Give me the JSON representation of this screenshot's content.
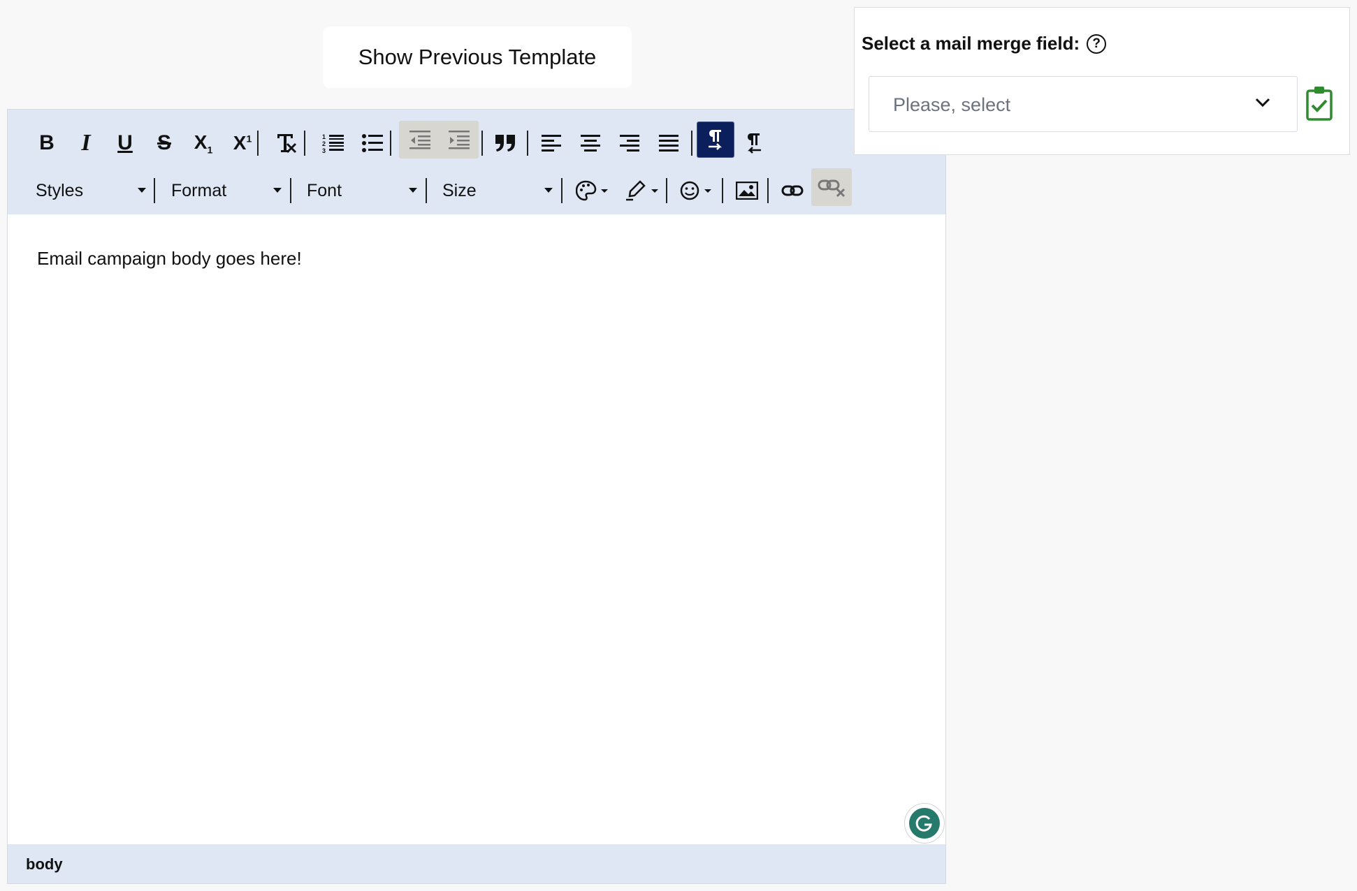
{
  "header": {
    "show_previous_label": "Show Previous Template"
  },
  "editor": {
    "toolbar_row1": [
      {
        "name": "bold-button",
        "icon": "bold-icon",
        "glyph": "B"
      },
      {
        "name": "italic-button",
        "icon": "italic-icon",
        "glyph": "I"
      },
      {
        "name": "underline-button",
        "icon": "underline-icon",
        "glyph": "U"
      },
      {
        "name": "strikethrough-button",
        "icon": "strikethrough-icon",
        "glyph": "S"
      },
      {
        "name": "subscript-button",
        "icon": "subscript-icon",
        "glyph": "X₁"
      },
      {
        "name": "superscript-button",
        "icon": "superscript-icon",
        "glyph": "X¹"
      },
      {
        "name": "remove-format-button",
        "icon": "remove-format-icon"
      },
      {
        "name": "numbered-list-button",
        "icon": "numbered-list-icon"
      },
      {
        "name": "bulleted-list-button",
        "icon": "bulleted-list-icon"
      },
      {
        "name": "decrease-indent-button",
        "icon": "outdent-icon"
      },
      {
        "name": "increase-indent-button",
        "icon": "indent-icon"
      },
      {
        "name": "blockquote-button",
        "icon": "quote-icon"
      },
      {
        "name": "align-left-button",
        "icon": "align-left-icon"
      },
      {
        "name": "align-center-button",
        "icon": "align-center-icon"
      },
      {
        "name": "align-right-button",
        "icon": "align-right-icon"
      },
      {
        "name": "justify-button",
        "icon": "justify-icon"
      },
      {
        "name": "ltr-button",
        "icon": "text-direction-ltr-icon",
        "active": true
      },
      {
        "name": "rtl-button",
        "icon": "text-direction-rtl-icon"
      }
    ],
    "combos": {
      "styles": "Styles",
      "format": "Format",
      "font": "Font",
      "size": "Size"
    },
    "body_text": "Email campaign body goes here!",
    "status_path": "body",
    "active_color": "#0b1f5c"
  },
  "merge_panel": {
    "title": "Select a mail merge field:",
    "help_glyph": "?",
    "select_placeholder": "Please, select",
    "accent_color": "#2e8b2e"
  }
}
